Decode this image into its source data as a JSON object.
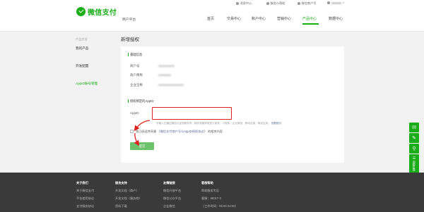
{
  "topbar": {
    "items": [
      {
        "label": "消息中心",
        "icon": "bell-icon"
      },
      {
        "label": "服务与帮助",
        "icon": "help-icon"
      },
      {
        "label": "微信商户号",
        "icon": "wechat-icon"
      },
      {
        "label": "",
        "icon": "user-icon"
      }
    ]
  },
  "brand": {
    "logo_text": "微信支付",
    "platform": "商户平台",
    "accent": "#1aad19"
  },
  "nav": {
    "items": [
      {
        "label": "首页"
      },
      {
        "label": "交易中心"
      },
      {
        "label": "账户中心"
      },
      {
        "label": "营销中心"
      },
      {
        "label": "产品中心"
      },
      {
        "label": "数据中心"
      }
    ],
    "active": "产品中心"
  },
  "sidebar": {
    "group": "产品大全",
    "items": [
      {
        "label": "我的产品"
      },
      {
        "label": "开发配置"
      },
      {
        "label": "AppID账号管理"
      }
    ],
    "active": "AppID账号管理"
  },
  "page": {
    "title": "新增授权"
  },
  "basic_info": {
    "title": "基础信息",
    "fields": [
      {
        "label": "商户号",
        "value": "1xxxxxxxxx"
      },
      {
        "label": "商户简称",
        "value": "xxxxxxxx"
      },
      {
        "label": "企业全称",
        "value": "xxxxxxxxxxxxxxxx"
      }
    ]
  },
  "appid_section": {
    "title": "授权绑定的AppID",
    "field_label": "AppID",
    "input_value": "",
    "hint": "可输入已通过微信认证的服务号、政府或媒体类型订阅号、小程序、企业微信、移动应用、网站应用。",
    "hint_link": "查看指引"
  },
  "agreement": {
    "prefix": "我已阅读并同意",
    "link": "《微信支付商户号与AppID授权协议》",
    "suffix": "的相关内容",
    "checked": false
  },
  "submit": {
    "label": "提交",
    "color": "#6cc26a"
  },
  "side_tools": [
    {
      "icon": "chat-icon"
    },
    {
      "icon": "edit-icon"
    },
    {
      "icon": "link-icon"
    },
    {
      "icon": "feedback-icon",
      "label": "问题反馈"
    }
  ],
  "footer": {
    "columns": [
      {
        "heading": "关于我们",
        "items": [
          "关于微信支付",
          "平台使用协议",
          "支付服务协议"
        ]
      },
      {
        "heading": "服务支持",
        "items": [
          "开发文档（商户）",
          "开发文档（服务商）",
          "资料下载"
        ]
      },
      {
        "heading": "友情链接",
        "items": [
          "微信开放平台",
          "微信公众平台",
          "企业微信"
        ]
      },
      {
        "heading": "客服帮助",
        "items": [
          "帮助服务专区",
          "客服：95017-2",
          "（工作时间：09:00-22:00）"
        ]
      }
    ]
  },
  "annotation_color": "#e02020"
}
